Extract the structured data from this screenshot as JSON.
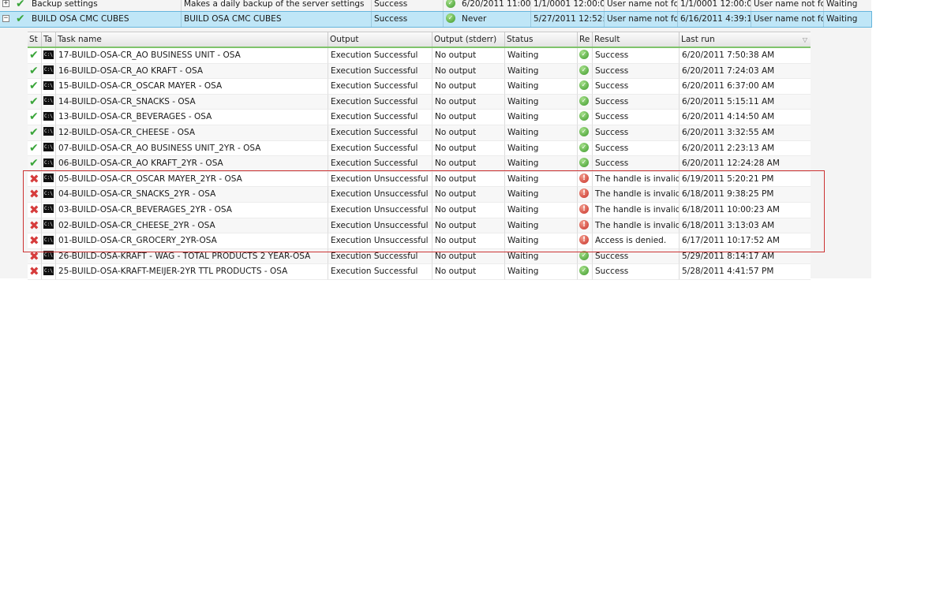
{
  "master_rows": [
    {
      "expander": "+",
      "name": "Backup settings",
      "description": "Makes a daily backup of the server settings",
      "status": "Success",
      "last_run": "6/20/2011 11:00:",
      "next_run": "1/1/0001 12:00:0",
      "run_as": "User name not fo",
      "modified": "1/1/0001 12:00:0",
      "modified_by": "User name not fo",
      "state": "Waiting"
    },
    {
      "expander": "−",
      "name": "BUILD OSA CMC CUBES",
      "description": "BUILD OSA CMC CUBES",
      "status": "Success",
      "last_run": "Never",
      "next_run": "5/27/2011 12:52:",
      "run_as": "User name not fo",
      "modified": "6/16/2011 4:39:1",
      "modified_by": "User name not fo",
      "state": "Waiting"
    }
  ],
  "detail": {
    "headers": {
      "st": "St",
      "ta": "Ta",
      "task_name": "Task name",
      "output": "Output",
      "stderr": "Output (stderr)",
      "status": "Status",
      "re": "Re",
      "result": "Result",
      "last_run": "Last run"
    },
    "rows": [
      {
        "state": "ok",
        "task": "17-BUILD-OSA-CR_AO BUSINESS UNIT - OSA",
        "output": "Execution Successful",
        "stderr": "No output",
        "status": "Waiting",
        "res_icon": "ok",
        "result": "Success",
        "last_run": "6/20/2011 7:50:38 AM"
      },
      {
        "state": "ok",
        "task": "16-BUILD-OSA-CR_AO KRAFT - OSA",
        "output": "Execution Successful",
        "stderr": "No output",
        "status": "Waiting",
        "res_icon": "ok",
        "result": "Success",
        "last_run": "6/20/2011 7:24:03 AM"
      },
      {
        "state": "ok",
        "task": "15-BUILD-OSA-CR_OSCAR MAYER - OSA",
        "output": "Execution Successful",
        "stderr": "No output",
        "status": "Waiting",
        "res_icon": "ok",
        "result": "Success",
        "last_run": "6/20/2011 6:37:00 AM"
      },
      {
        "state": "ok",
        "task": "14-BUILD-OSA-CR_SNACKS - OSA",
        "output": "Execution Successful",
        "stderr": "No output",
        "status": "Waiting",
        "res_icon": "ok",
        "result": "Success",
        "last_run": "6/20/2011 5:15:11 AM"
      },
      {
        "state": "ok",
        "task": "13-BUILD-OSA-CR_BEVERAGES - OSA",
        "output": "Execution Successful",
        "stderr": "No output",
        "status": "Waiting",
        "res_icon": "ok",
        "result": "Success",
        "last_run": "6/20/2011 4:14:50 AM"
      },
      {
        "state": "ok",
        "task": "12-BUILD-OSA-CR_CHEESE - OSA",
        "output": "Execution Successful",
        "stderr": "No output",
        "status": "Waiting",
        "res_icon": "ok",
        "result": "Success",
        "last_run": "6/20/2011 3:32:55 AM"
      },
      {
        "state": "ok",
        "task": "07-BUILD-OSA-CR_AO BUSINESS UNIT_2YR - OSA",
        "output": "Execution Successful",
        "stderr": "No output",
        "status": "Waiting",
        "res_icon": "ok",
        "result": "Success",
        "last_run": "6/20/2011 2:23:13 AM"
      },
      {
        "state": "ok",
        "task": "06-BUILD-OSA-CR_AO KRAFT_2YR - OSA",
        "output": "Execution Successful",
        "stderr": "No output",
        "status": "Waiting",
        "res_icon": "ok",
        "result": "Success",
        "last_run": "6/20/2011 12:24:28 AM"
      },
      {
        "state": "fail",
        "task": "05-BUILD-OSA-CR_OSCAR MAYER_2YR - OSA",
        "output": "Execution Unsuccessful",
        "stderr": "No output",
        "status": "Waiting",
        "res_icon": "err",
        "result": "The handle is invalid.",
        "last_run": "6/19/2011 5:20:21 PM"
      },
      {
        "state": "fail",
        "task": "04-BUILD-OSA-CR_SNACKS_2YR - OSA",
        "output": "Execution Unsuccessful",
        "stderr": "No output",
        "status": "Waiting",
        "res_icon": "err",
        "result": "The handle is invalid.",
        "last_run": "6/18/2011 9:38:25 PM"
      },
      {
        "state": "fail",
        "task": "03-BUILD-OSA-CR_BEVERAGES_2YR - OSA",
        "output": "Execution Unsuccessful",
        "stderr": "No output",
        "status": "Waiting",
        "res_icon": "err",
        "result": "The handle is invalid.",
        "last_run": "6/18/2011 10:00:23 AM"
      },
      {
        "state": "fail",
        "task": "02-BUILD-OSA-CR_CHEESE_2YR - OSA",
        "output": "Execution Unsuccessful",
        "stderr": "No output",
        "status": "Waiting",
        "res_icon": "err",
        "result": "The handle is invalid.",
        "last_run": "6/18/2011 3:13:03 AM"
      },
      {
        "state": "fail",
        "task": "01-BUILD-OSA-CR_GROCERY_2YR-OSA",
        "output": "Execution Unsuccessful",
        "stderr": "No output",
        "status": "Waiting",
        "res_icon": "err",
        "result": "Access is denied.",
        "last_run": "6/17/2011 10:17:52 AM"
      },
      {
        "state": "fail",
        "task": "26-BUILD-OSA-KRAFT - WAG - TOTAL PRODUCTS 2 YEAR-OSA",
        "output": "Execution Successful",
        "stderr": "No output",
        "status": "Waiting",
        "res_icon": "ok",
        "result": "Success",
        "last_run": "5/29/2011 8:14:17 AM"
      },
      {
        "state": "fail",
        "task": "25-BUILD-OSA-KRAFT-MEIJER-2YR TTL PRODUCTS - OSA",
        "output": "Execution Successful",
        "stderr": "No output",
        "status": "Waiting",
        "res_icon": "ok",
        "result": "Success",
        "last_run": "5/28/2011 4:41:57 PM"
      }
    ]
  },
  "icons": {
    "ok_state": "check-icon",
    "fail_state": "x-icon",
    "task_type": "cmd-icon",
    "result_ok": "ok-circle-icon",
    "result_err": "error-circle-icon"
  },
  "colors": {
    "selection": "#bfe6f7",
    "header_underline": "#7fc36b",
    "highlight_box": "#cc3333",
    "success_green": "#3aa53a",
    "failure_red": "#d63c3c"
  }
}
